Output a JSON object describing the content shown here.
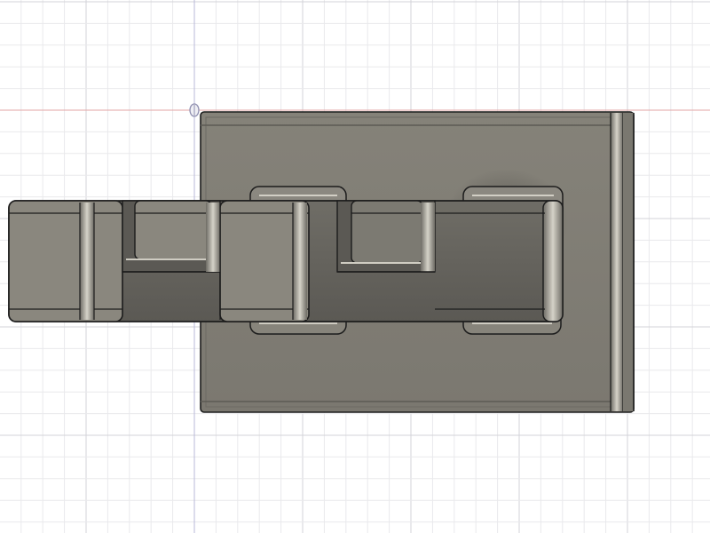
{
  "viewport": {
    "background": "#ffffff",
    "grid_minor_color": "#e9e9ec",
    "grid_major_color": "#d3d3d8",
    "axis_red_color": "#e3a6a6",
    "axis_blue_color": "#b9b9d9",
    "shading_enabled": true
  },
  "model": {
    "body_color": "#7c7a72",
    "body_dark_color": "#5f5d57",
    "edge_color": "#1c1c1c",
    "highlight_color": "#c9c6bd"
  },
  "origin_icon": "origin-point-icon"
}
